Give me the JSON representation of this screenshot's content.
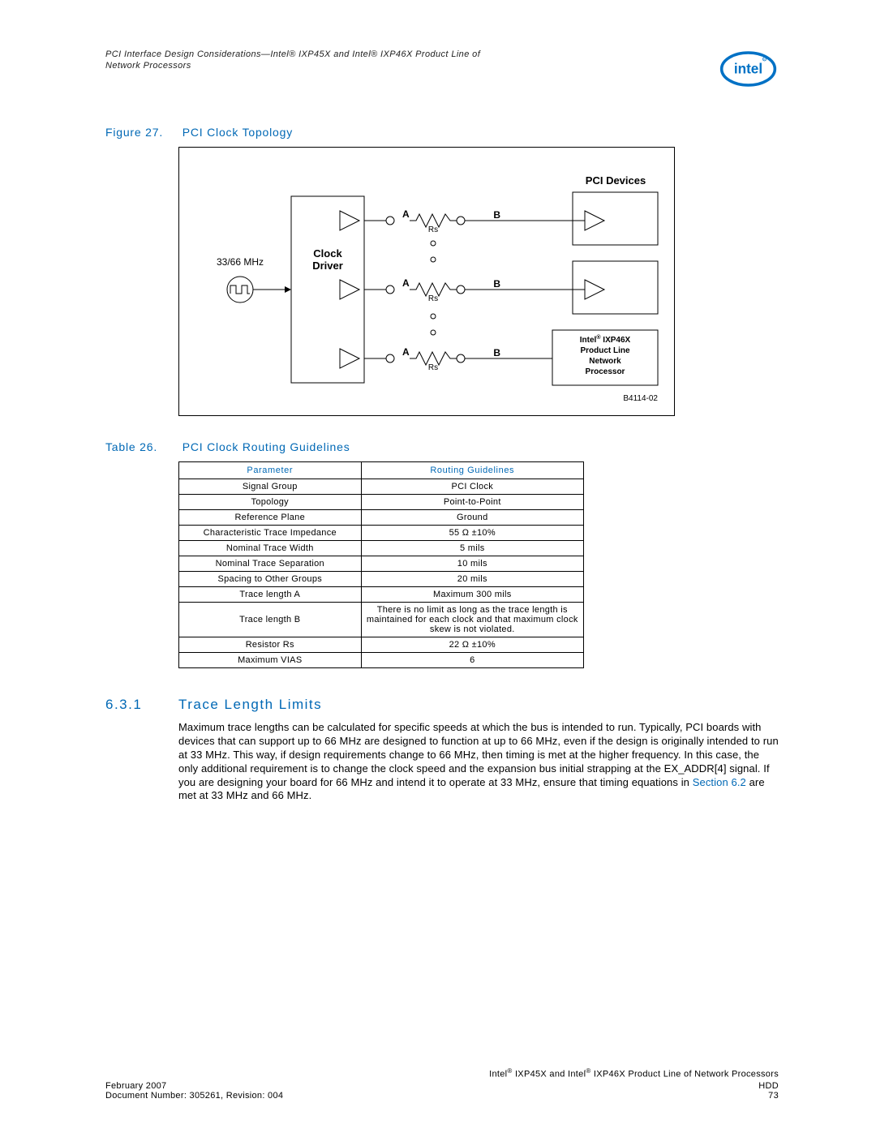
{
  "header": {
    "title_line1": "PCI Interface Design Considerations—Intel® IXP45X and Intel® IXP46X Product Line of",
    "title_line2": "Network Processors",
    "logo_text": "intel"
  },
  "figure": {
    "label": "Figure 27.",
    "title": "PCI Clock Topology",
    "freq": "33/66 MHz",
    "clock_driver": "Clock\nDriver",
    "pci_devices": "PCI Devices",
    "a": "A",
    "b": "B",
    "rs": "Rs",
    "device_label_l1": "Intel® IXP46X",
    "device_label_l2": "Product Line",
    "device_label_l3": "Network",
    "device_label_l4": "Processor",
    "refnum": "B4114-02"
  },
  "table": {
    "label": "Table 26.",
    "title": "PCI Clock Routing Guidelines",
    "headers": {
      "c1": "Parameter",
      "c2": "Routing Guidelines"
    },
    "rows": [
      {
        "p": "Signal Group",
        "v": "PCI Clock"
      },
      {
        "p": "Topology",
        "v": "Point-to-Point"
      },
      {
        "p": "Reference Plane",
        "v": "Ground"
      },
      {
        "p": "Characteristic Trace Impedance",
        "v": "55 Ω ±10%"
      },
      {
        "p": "Nominal Trace Width",
        "v": "5 mils"
      },
      {
        "p": "Nominal Trace Separation",
        "v": "10 mils"
      },
      {
        "p": "Spacing to Other Groups",
        "v": "20 mils"
      },
      {
        "p": "Trace length A",
        "v": "Maximum 300 mils"
      },
      {
        "p": "Trace length B",
        "v": "There is no limit as long as the trace length is maintained for each clock and that maximum clock skew is not violated."
      },
      {
        "p": "Resistor Rs",
        "v": "22 Ω ±10%"
      },
      {
        "p": "Maximum VIAS",
        "v": "6"
      }
    ]
  },
  "section": {
    "number": "6.3.1",
    "title": "Trace Length Limits",
    "body_pre": "Maximum trace lengths can be calculated for specific speeds at which the bus is intended to run. Typically, PCI boards with devices that can support up to 66 MHz are designed to function at up to 66 MHz, even if the design is originally intended to run at 33 MHz. This way, if design requirements change to 66 MHz, then timing is met at the higher frequency. In this case, the only additional requirement is to change the clock speed and the expansion bus initial strapping at the EX_ADDR[4] signal. If you are designing your board for 66 MHz and intend it to operate at 33 MHz, ensure that timing equations in ",
    "body_link": "Section 6.2",
    "body_post": " are met at 33 MHz and 66 MHz."
  },
  "footer": {
    "right_top": "Intel® IXP45X and Intel® IXP46X Product Line of Network Processors",
    "left1": "February 2007",
    "right1": "HDD",
    "left2": "Document Number: 305261, Revision: 004",
    "right2": "73"
  }
}
